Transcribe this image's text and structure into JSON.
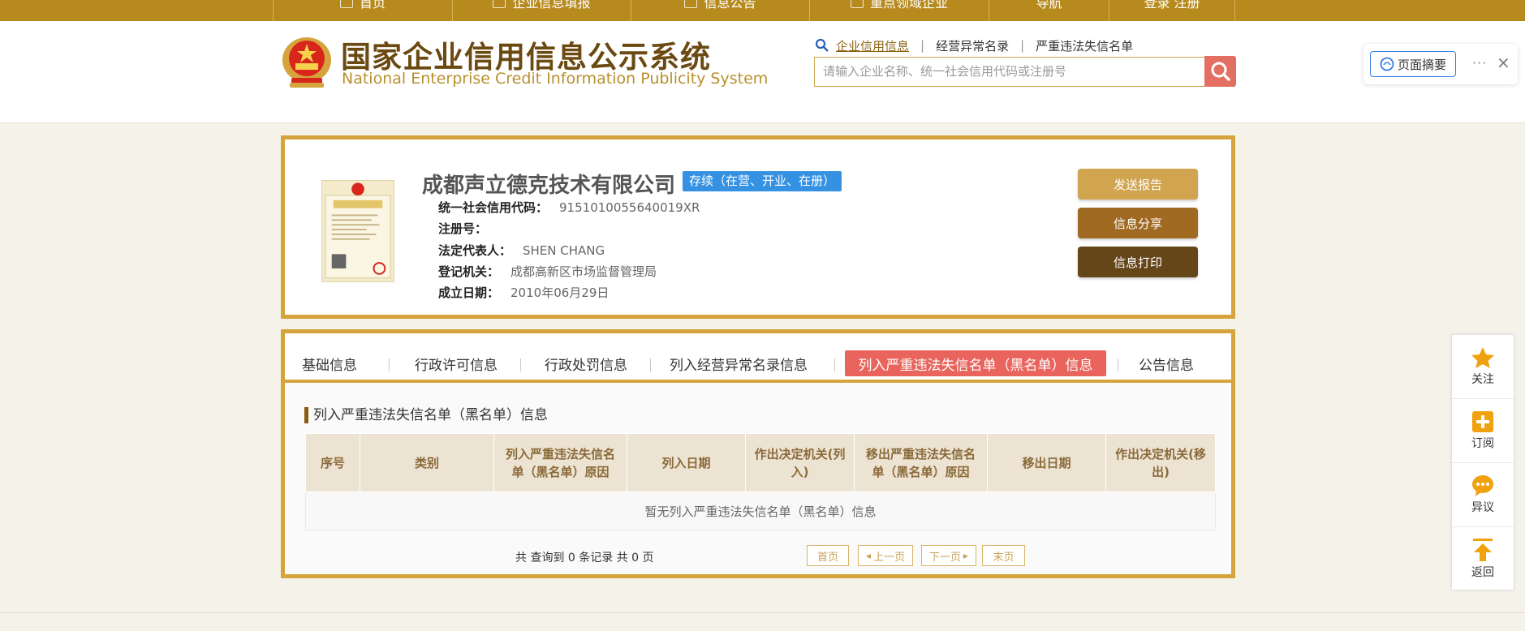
{
  "nav": {
    "items": [
      {
        "label": "首页"
      },
      {
        "label": "企业信息填报"
      },
      {
        "label": "信息公告"
      },
      {
        "label": "重点领域企业"
      },
      {
        "label": "导航"
      },
      {
        "label": "登录 注册"
      }
    ]
  },
  "header": {
    "title_cn": "国家企业信用信息公示系统",
    "title_en": "National Enterprise Credit Information Publicity System",
    "search_tabs": [
      "企业信用信息",
      "经营异常名录",
      "严重违法失信名单"
    ],
    "search_placeholder": "请输入企业名称、统一社会信用代码或注册号"
  },
  "summary_widget": {
    "button_label": "页面摘要",
    "more": "···",
    "close": "×"
  },
  "company": {
    "name": "成都声立德克技术有限公司",
    "status": "存续（在营、开业、在册）",
    "fields": [
      {
        "label": "统一社会信用代码：",
        "value": "9151010055640019XR"
      },
      {
        "label": "注册号：",
        "value": ""
      },
      {
        "label": "法定代表人：",
        "value": "SHEN CHANG"
      },
      {
        "label": "登记机关：",
        "value": "成都高新区市场监督管理局"
      },
      {
        "label": "成立日期：",
        "value": "2010年06月29日"
      }
    ],
    "actions": [
      "发送报告",
      "信息分享",
      "信息打印"
    ]
  },
  "tabs": [
    "基础信息",
    "行政许可信息",
    "行政处罚信息",
    "列入经营异常名录信息",
    "列入严重违法失信名单（黑名单）信息",
    "公告信息"
  ],
  "active_tab": "列入严重违法失信名单（黑名单）信息",
  "section": {
    "title": "列入严重违法失信名单（黑名单）信息",
    "table": {
      "headers": [
        "序号",
        "类别",
        "列入严重违法失信名单（黑名单）原因",
        "列入日期",
        "作出决定机关(列入)",
        "移出严重违法失信名单（黑名单）原因",
        "移出日期",
        "作出决定机关(移出)"
      ],
      "empty_text": "暂无列入严重违法失信名单（黑名单）信息"
    },
    "pager": {
      "summary": "共 查询到 0 条记录 共 0 页",
      "first": "首页",
      "prev": "上一页",
      "next": "下一页",
      "last": "末页"
    }
  },
  "float_toolbar": [
    "关注",
    "订阅",
    "异议",
    "返回"
  ],
  "colors": {
    "nav_bg": "#b78a1e",
    "gold_border": "#d6a43c",
    "active_tab": "#e9645c",
    "status_badge": "#3592e3",
    "btn_send": "#d1a44f",
    "btn_share": "#a06a22",
    "btn_print": "#654619"
  }
}
